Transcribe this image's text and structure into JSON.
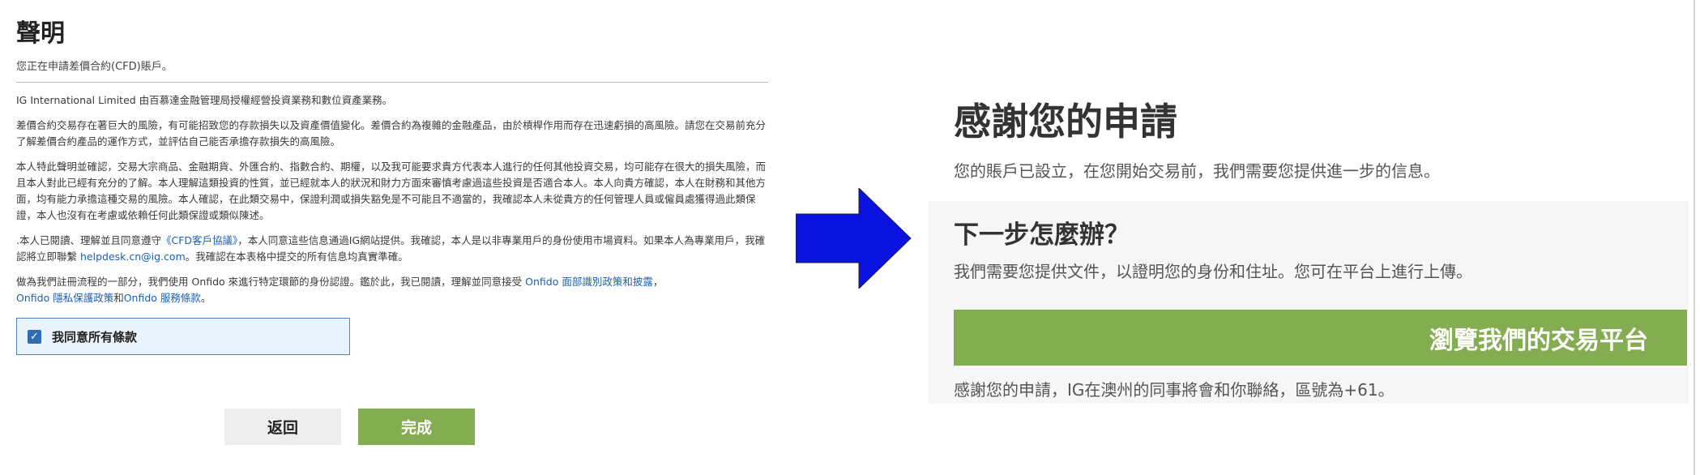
{
  "declaration": {
    "title": "聲明",
    "subtitle": "您正在申請差價合約(CFD)賬戶。",
    "p1": "IG International Limited 由百慕達金融管理局授權經營投資業務和數位資產業務。",
    "p2": "差價合約交易存在著巨大的風險，有可能招致您的存款損失以及資產價值變化。差價合約為複雜的金融產品，由於槓桿作用而存在迅速虧損的高風險。請您在交易前充分了解差價合約產品的運作方式，並評估自己能否承擔存款損失的高風險。",
    "p3": "本人特此聲明並確認，交易大宗商品、金融期貨、外匯合約、指數合約、期權，以及我可能要求貴方代表本人進行的任何其他投資交易，均可能存在很大的損失風險，而且本人對此已經有充分的了解。本人理解這類投資的性質，並已經就本人的狀況和財力方面來審慎考慮過這些投資是否適合本人。本人向貴方確認，本人在財務和其他方面，均有能力承擔這種交易的風險。本人確認，在此類交易中，保證利潤或損失豁免是不可能且不適當的，我確認本人未從貴方的任何管理人員或僱員處獲得過此類保證，本人也沒有在考慮或依賴任何此類保證或類似陳述。",
    "p4_a": ".本人已閱讀、理解並且同意遵守",
    "p4_link": "《CFD客戶協議》",
    "p4_b": "，本人同意這些信息通過IG網站提供。我確認，本人是以非專業用戶的身份使用市場資料。如果本人為專業用戶，我確認將立即聯繫",
    "p4_email": "helpdesk.cn@ig.com",
    "p4_c": "。我確認在本表格中提交的所有信息均真實準確。",
    "p5_a": "做為我們註冊流程的一部分，我們使用 Onfido 來進行特定環節的身份認證。鑑於此，我已閱讀，理解並同意接受",
    "p5_link1": "Onfido 面部識別政策和披露",
    "p5_b": "，",
    "p5_link2": "Onfido 隱私保護政策",
    "p5_c": "和",
    "p5_link3": "Onfido 服務條款",
    "p5_d": "。",
    "agree_label": "我同意所有條款",
    "check_mark": "✓",
    "back_label": "返回",
    "done_label": "完成"
  },
  "confirmation": {
    "title": "感謝您的申請",
    "subtitle": "您的賬戶已設立，在您開始交易前，我們需要您提供進一步的信息。",
    "next_title": "下一步怎麼辦？",
    "next_desc": "我們需要您提供文件，以證明您的身份和住址。您可在平台上進行上傳。",
    "browse_label": "瀏覽我們的交易平台",
    "thanks_note": "感謝您的申請，IG在澳州的同事將會和你聯絡，區號為+61。"
  },
  "colors": {
    "accent_green": "#84ac51",
    "link_blue": "#1a5fb4",
    "arrow_blue": "#0a12e0",
    "checkbox_blue": "#2f6db3"
  },
  "icons": {
    "arrow": "right-arrow-icon",
    "checkbox": "checkbox-checked-icon"
  }
}
